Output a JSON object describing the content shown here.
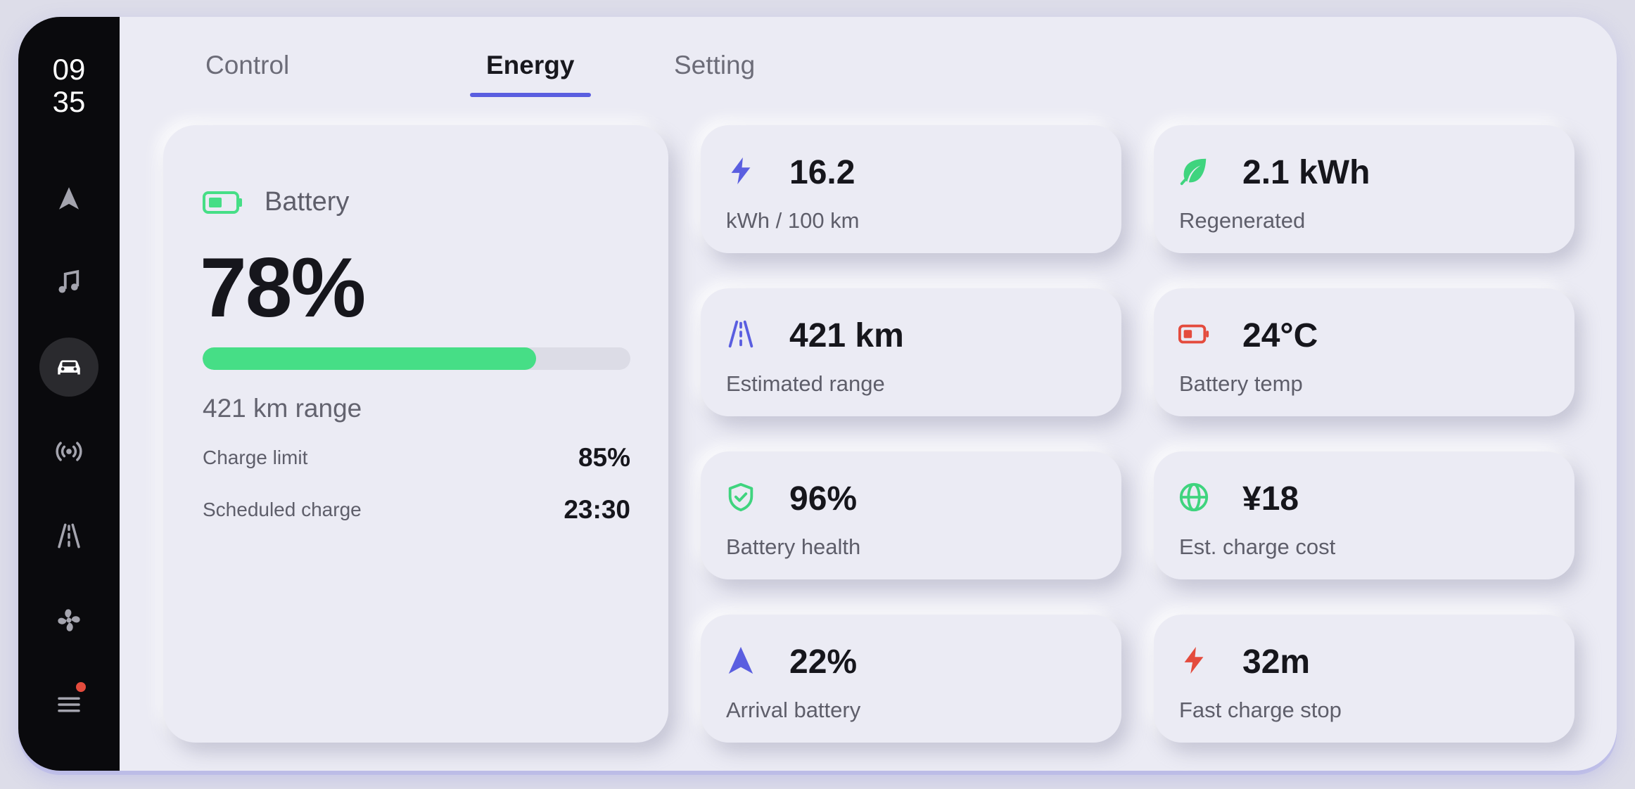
{
  "clock": {
    "hour": "09",
    "minute": "35"
  },
  "sidebar": {
    "items": [
      {
        "icon": "navigation-arrow-icon",
        "active": false
      },
      {
        "icon": "music-note-icon",
        "active": false
      },
      {
        "icon": "car-icon",
        "active": true
      },
      {
        "icon": "radio-signal-icon",
        "active": false
      },
      {
        "icon": "road-icon",
        "active": false
      },
      {
        "icon": "fan-icon",
        "active": false
      },
      {
        "icon": "menu-icon",
        "active": false,
        "has_badge": true
      }
    ]
  },
  "tabs": [
    {
      "label": "Control",
      "active": false
    },
    {
      "label": "Energy",
      "active": true
    },
    {
      "label": "Setting",
      "active": false
    }
  ],
  "battery": {
    "title": "Battery",
    "percent_text": "78%",
    "level": 0.78,
    "range_text": "421 km range",
    "rows": [
      {
        "label": "Charge limit",
        "value": "85%"
      },
      {
        "label": "Scheduled charge",
        "value": "23:30"
      }
    ]
  },
  "stats": [
    {
      "value": "16.2",
      "label": "kWh / 100 km",
      "icon": "lightning-icon",
      "color": "#5a5ee0"
    },
    {
      "value": "2.1 kWh",
      "label": "Regenerated",
      "icon": "leaf-icon",
      "color": "#3fd47e"
    },
    {
      "value": "421 km",
      "label": "Estimated range",
      "icon": "road-icon",
      "color": "#5a5ee0"
    },
    {
      "value": "24°C",
      "label": "Battery temp",
      "icon": "battery-icon",
      "color": "#e44b3d"
    },
    {
      "value": "96%",
      "label": "Battery health",
      "icon": "shield-check-icon",
      "color": "#3fd47e"
    },
    {
      "value": "¥18",
      "label": "Est. charge cost",
      "icon": "globe-icon",
      "color": "#3fd47e"
    },
    {
      "value": "22%",
      "label": "Arrival battery",
      "icon": "navigation-arrow-icon",
      "color": "#5a5ee0"
    },
    {
      "value": "32m",
      "label": "Fast charge stop",
      "icon": "lightning-icon",
      "color": "#e44b3d"
    }
  ],
  "colors": {
    "accent": "#5a5ee0",
    "success": "#46de86",
    "danger": "#e44b3d",
    "sidebar": "#0a0a0d",
    "background": "#ebebf4"
  }
}
